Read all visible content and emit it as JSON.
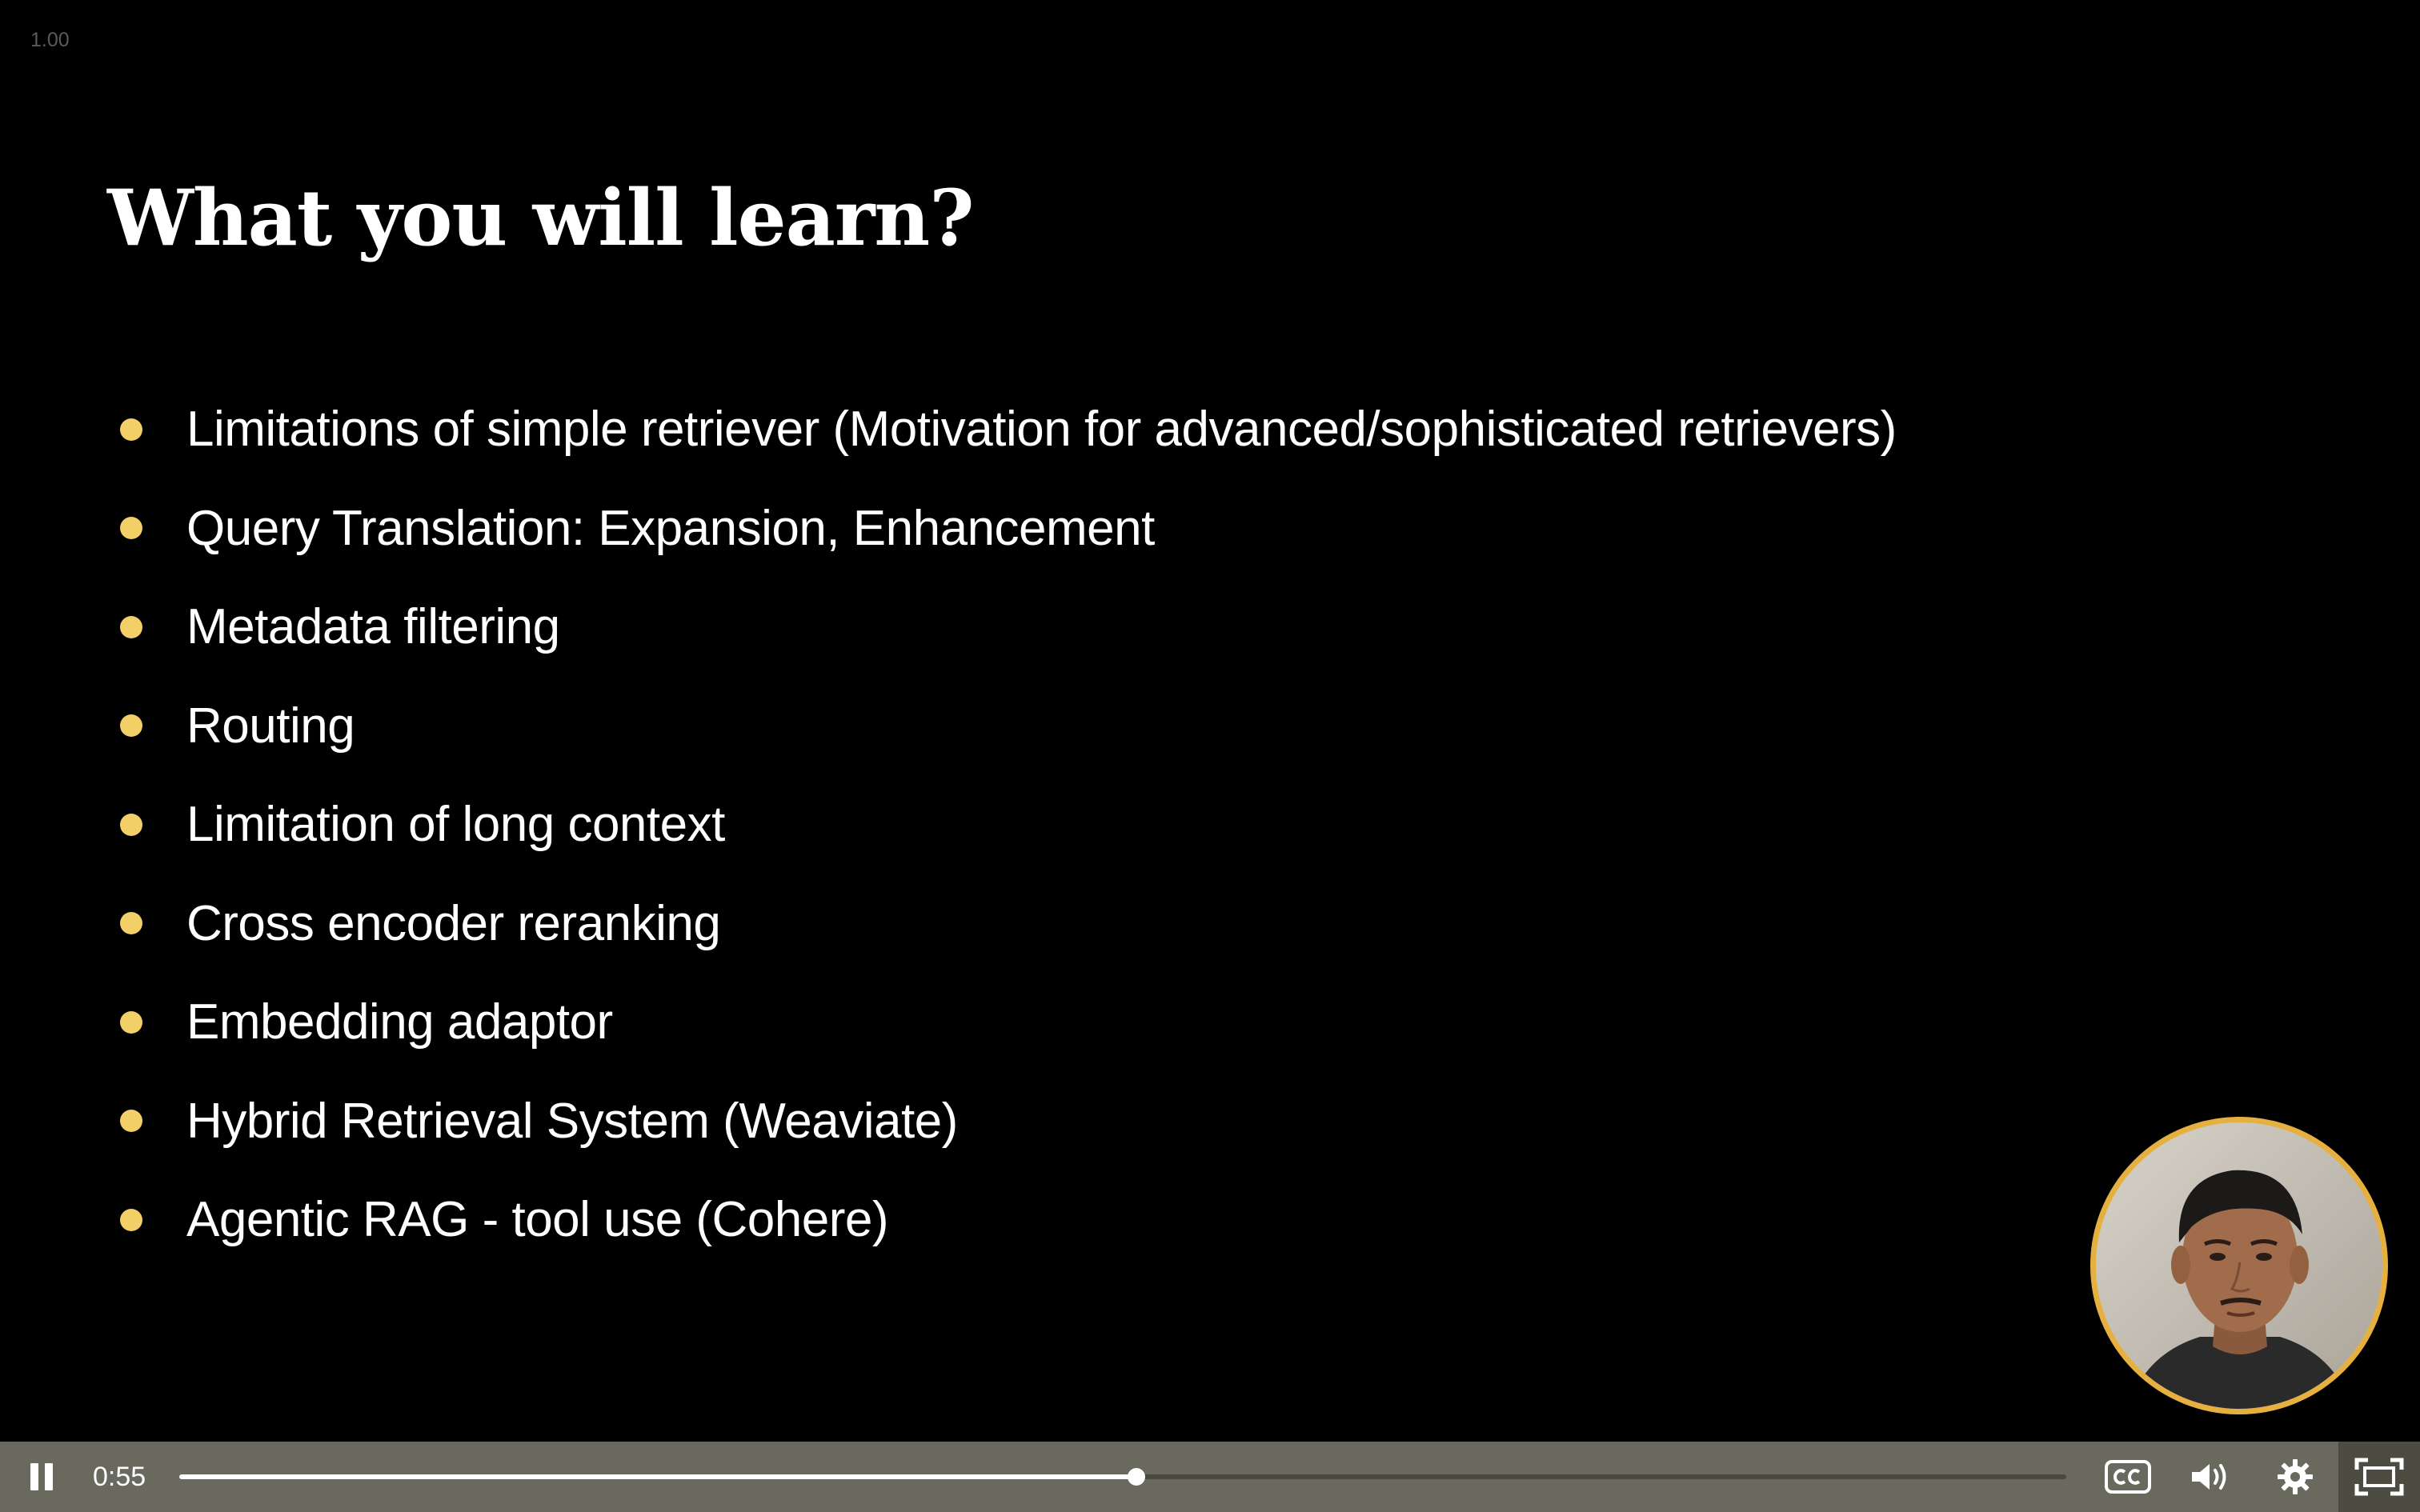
{
  "player": {
    "speed_label": "1.00",
    "current_time": "0:55",
    "progress_fraction": 0.507
  },
  "slide": {
    "title": "What you will learn?",
    "bullets": [
      "Limitations of simple retriever (Motivation for advanced/sophisticated  retrievers)",
      "Query Translation: Expansion, Enhancement",
      "Metadata filtering",
      "Routing",
      "Limitation of long context",
      "Cross encoder reranking",
      "Embedding adaptor",
      "Hybrid Retrieval System (Weaviate)",
      "Agentic RAG - tool use (Cohere)"
    ]
  },
  "colors": {
    "bullet_accent": "#f2cf67",
    "presenter_ring": "#e6b040",
    "controls_background": "#6a695d"
  },
  "icons": {
    "pause": "pause-icon",
    "captions": "closed-captions-icon",
    "volume": "volume-icon",
    "settings": "gear-icon",
    "fullscreen": "fullscreen-icon"
  }
}
